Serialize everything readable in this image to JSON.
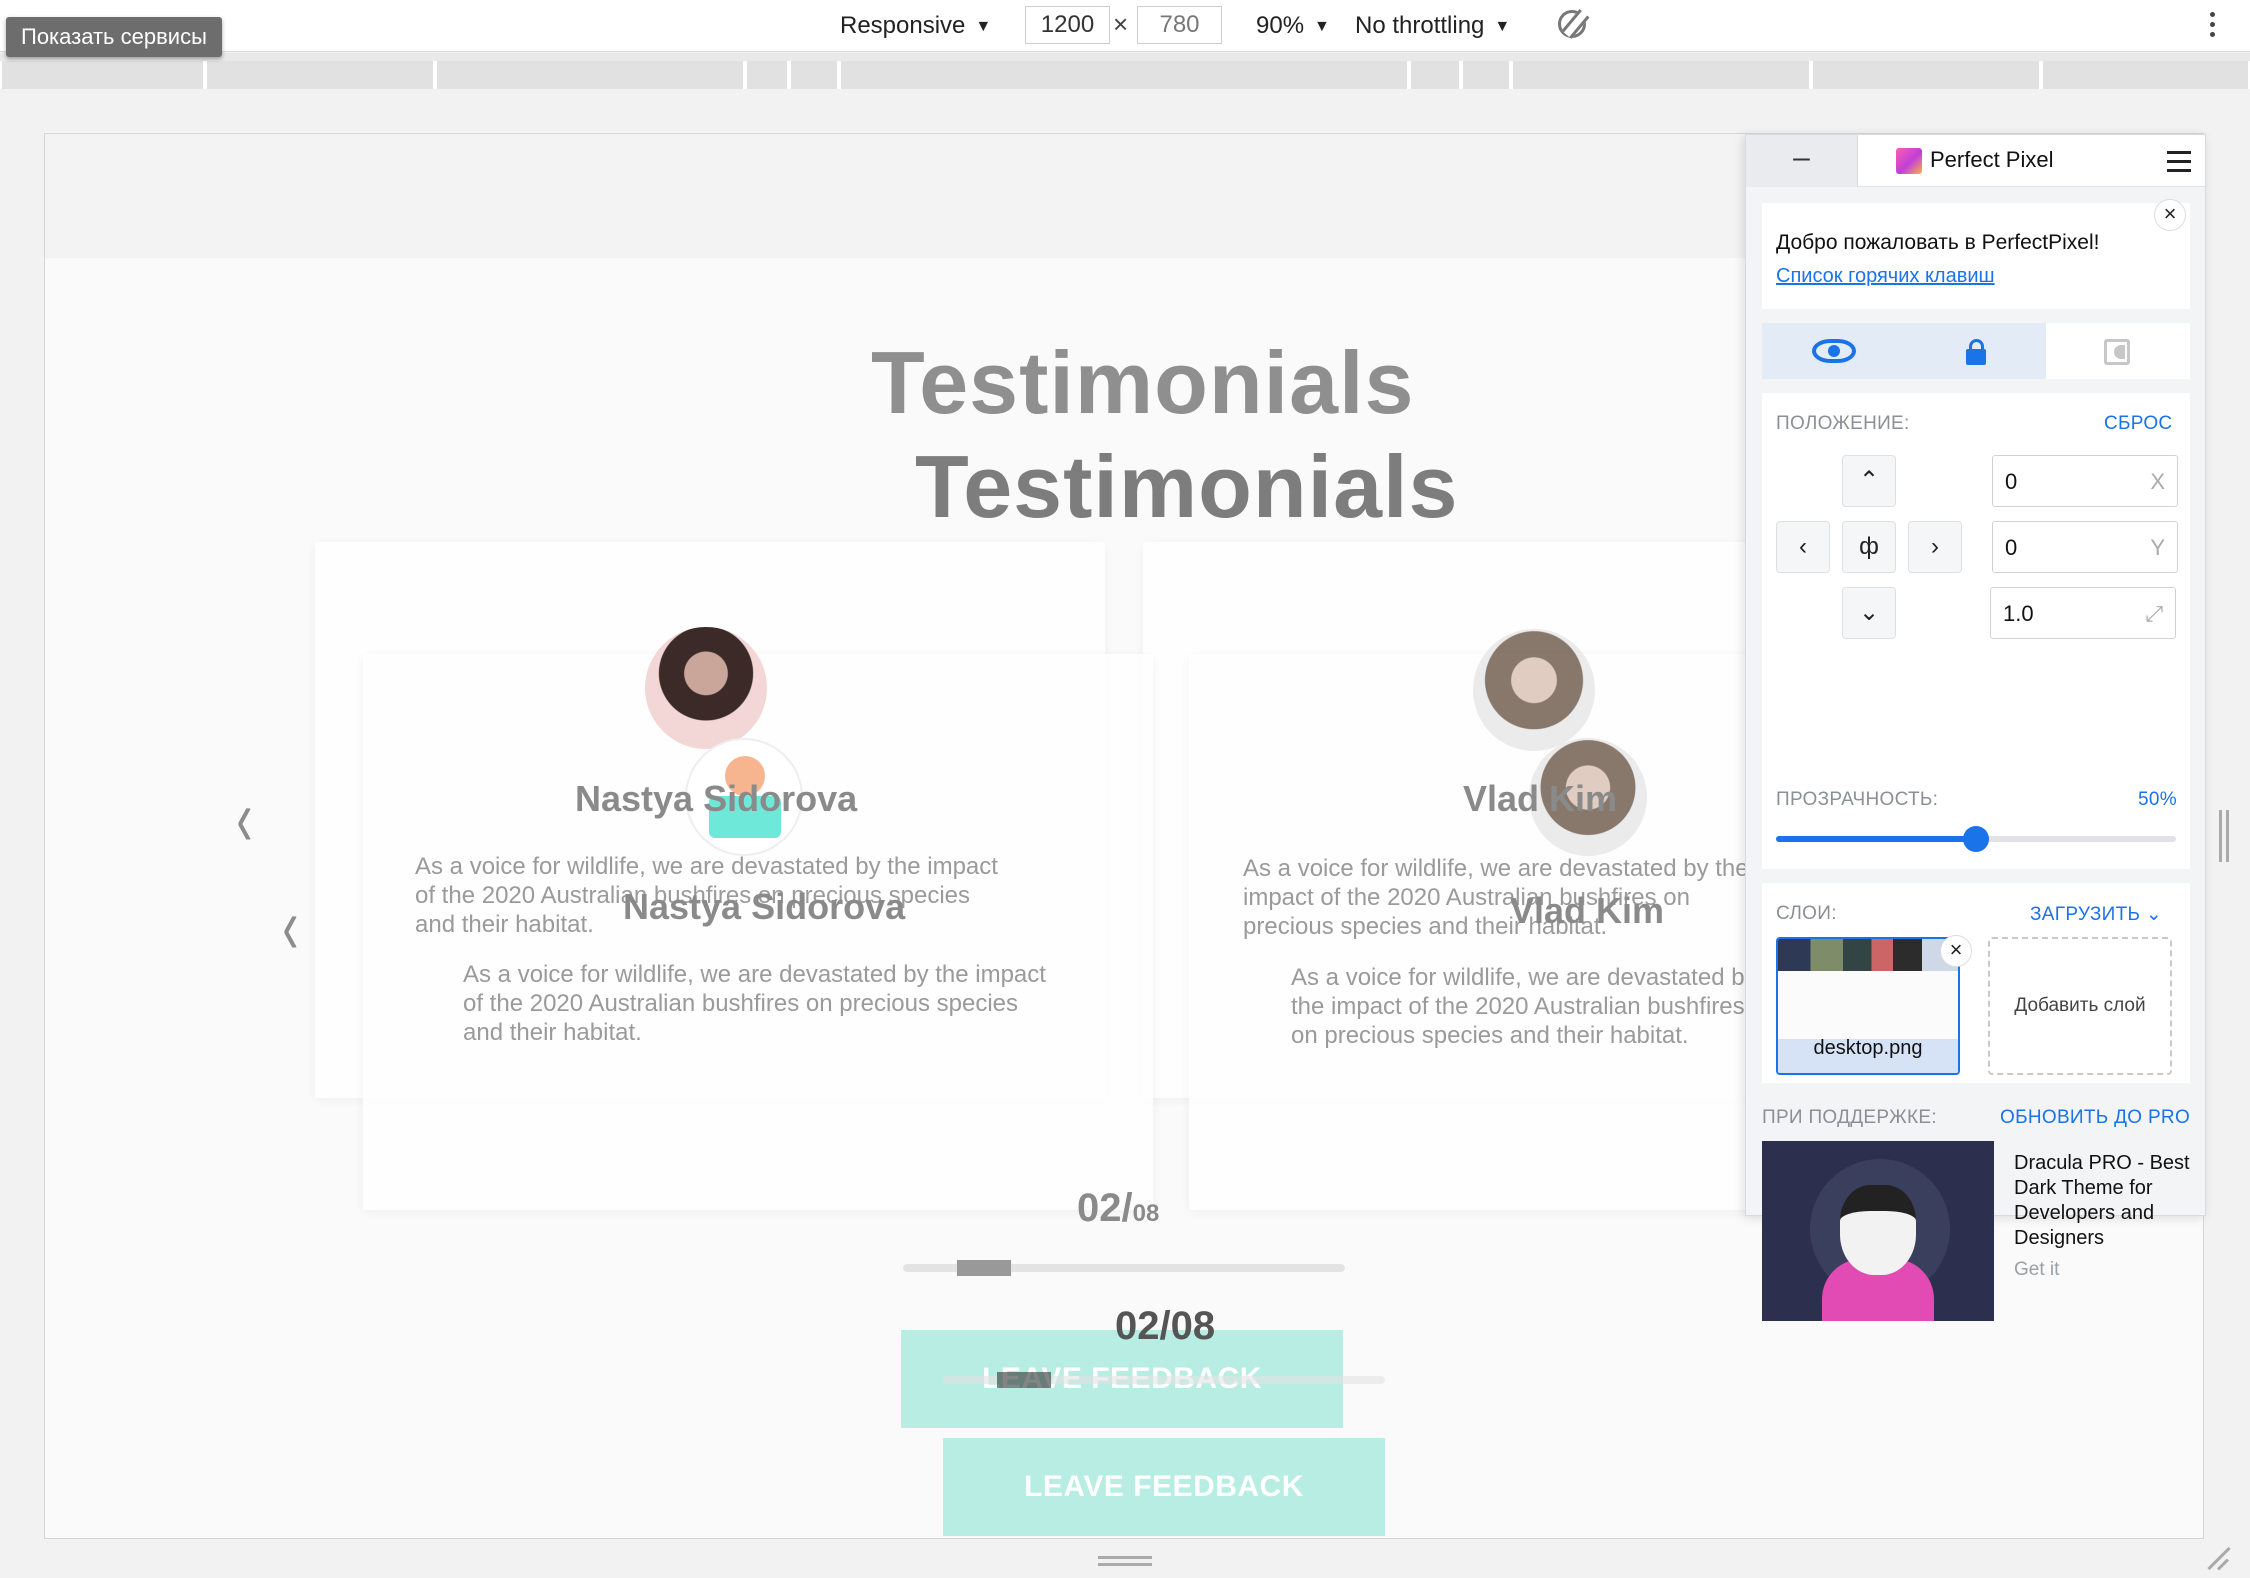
{
  "toolbar": {
    "services_button": "Показать сервисы",
    "device": "Responsive",
    "width": "1200",
    "height": "780",
    "zoom": "90%",
    "throttling": "No throttling",
    "icons": [
      "rotate-icon",
      "more-vert-icon",
      "caret-down-icon"
    ]
  },
  "page": {
    "title_back": "Testimonials",
    "title_front": "Testimonials",
    "card1_name_back": "Nastya Sidorova",
    "card1_name_front": "Nastya Sidorova",
    "card1_quote_back": "As a voice for wildlife, we are devastated by the impact of the 2020 Australian bushfires on precious species and their habitat.",
    "card1_quote_front": "As a voice for wildlife, we are devastated by the impact of the 2020 Australian bushfires on precious species and their habitat.",
    "card2_name_back": "Vlad Kim",
    "card2_name_front": "Vlad Kim",
    "card2_quote_back": "As a voice for wildlife, we are devastated by the impact of the 2020 Australian bushfires on precious species and their habitat.",
    "card2_quote_front": "As a voice for wildlife, we are devastated by the impact of the 2020 Australian bushfires on precious species and their habitat.",
    "counter_current": "02/",
    "counter_total": "08",
    "counter2": "02/08",
    "feedback_label": "LEAVE FEEDBACK",
    "icons": [
      "chevron-left-icon",
      "avatar-placeholder-icon"
    ]
  },
  "perfect_pixel": {
    "minimize": "–",
    "title": "Perfect Pixel",
    "welcome": "Добро пожаловать в PerfectPixel!",
    "hotkeys_link": "Список горячих клавиш",
    "position_label": "ПОЛОЖЕНИЕ:",
    "reset_label": "СБРОС",
    "center_symbol": "ф",
    "x_value": "0",
    "x_unit": "X",
    "y_value": "0",
    "y_unit": "Y",
    "scale_value": "1.0",
    "opacity_label": "ПРОЗРАЧНОСТЬ:",
    "opacity_value": "50%",
    "opacity_fraction": 0.5,
    "layers_label": "СЛОИ:",
    "upload_label": "ЗАГРУЗИТЬ",
    "layer_name": "desktop.png",
    "add_layer": "Добавить слой",
    "sponsor_label": "ПРИ ПОДДЕРЖКЕ:",
    "upgrade_label": "ОБНОВИТЬ ДО PRO",
    "ad_text": "Dracula PRO - Best Dark Theme for Developers and Designers",
    "ad_cta": "Get it",
    "accent_color": "#1a73e8",
    "icons": [
      "eye-icon",
      "lock-icon",
      "difference-icon",
      "hamburger-menu-icon",
      "close-icon",
      "arrow-up-icon",
      "arrow-down-icon",
      "arrow-left-icon",
      "arrow-right-icon",
      "resize-diagonal-icon"
    ]
  }
}
